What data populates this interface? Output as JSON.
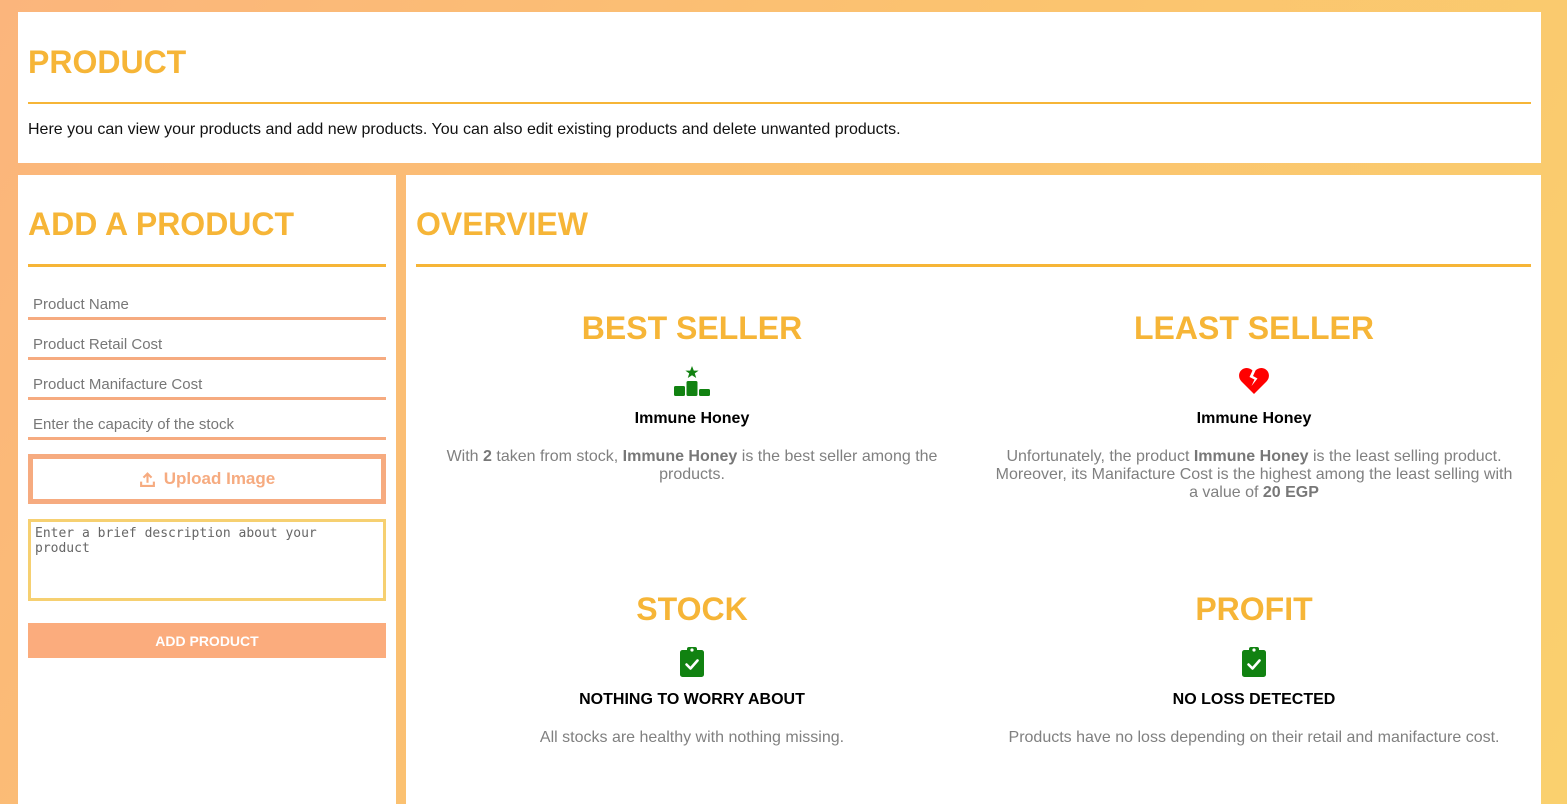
{
  "header": {
    "title": "PRODUCT",
    "subtitle": "Here you can view your products and add new products. You can also edit existing products and delete unwanted products."
  },
  "add_product": {
    "title": "ADD A PRODUCT",
    "name_placeholder": "Product Name",
    "retail_placeholder": "Product Retail Cost",
    "manufacture_placeholder": "Product Manifacture Cost",
    "capacity_placeholder": "Enter the capacity of the stock",
    "upload_label": "Upload Image",
    "description_placeholder": "Enter a brief description about your product",
    "submit_label": "ADD PRODUCT"
  },
  "overview": {
    "title": "OVERVIEW",
    "best_seller": {
      "heading": "BEST SELLER",
      "icon": "podium-star-icon",
      "name": "Immune Honey",
      "desc_pre": "With ",
      "count": "2",
      "desc_mid": " taken from stock, ",
      "product": "Immune Honey",
      "desc_post": " is the best seller among the products."
    },
    "least_seller": {
      "heading": "LEAST SELLER",
      "icon": "broken-heart-icon",
      "name": "Immune Honey",
      "desc_pre": "Unfortunately, the product ",
      "product": "Immune Honey",
      "desc_mid": " is the least selling product. Moreover, its Manifacture Cost is the highest among the least selling with a value of ",
      "value": "20 EGP"
    },
    "stock": {
      "heading": "STOCK",
      "icon": "clipboard-check-icon",
      "status": "NOTHING TO WORRY ABOUT",
      "desc": "All stocks are healthy with nothing missing."
    },
    "profit": {
      "heading": "PROFIT",
      "icon": "clipboard-check-icon",
      "status": "NO LOSS DETECTED",
      "desc": "Products have no loss depending on their retail and manifacture cost."
    }
  },
  "colors": {
    "accent": "#f6b537",
    "salmon": "#f6ab80",
    "green": "#118211",
    "red": "#ff0000"
  }
}
